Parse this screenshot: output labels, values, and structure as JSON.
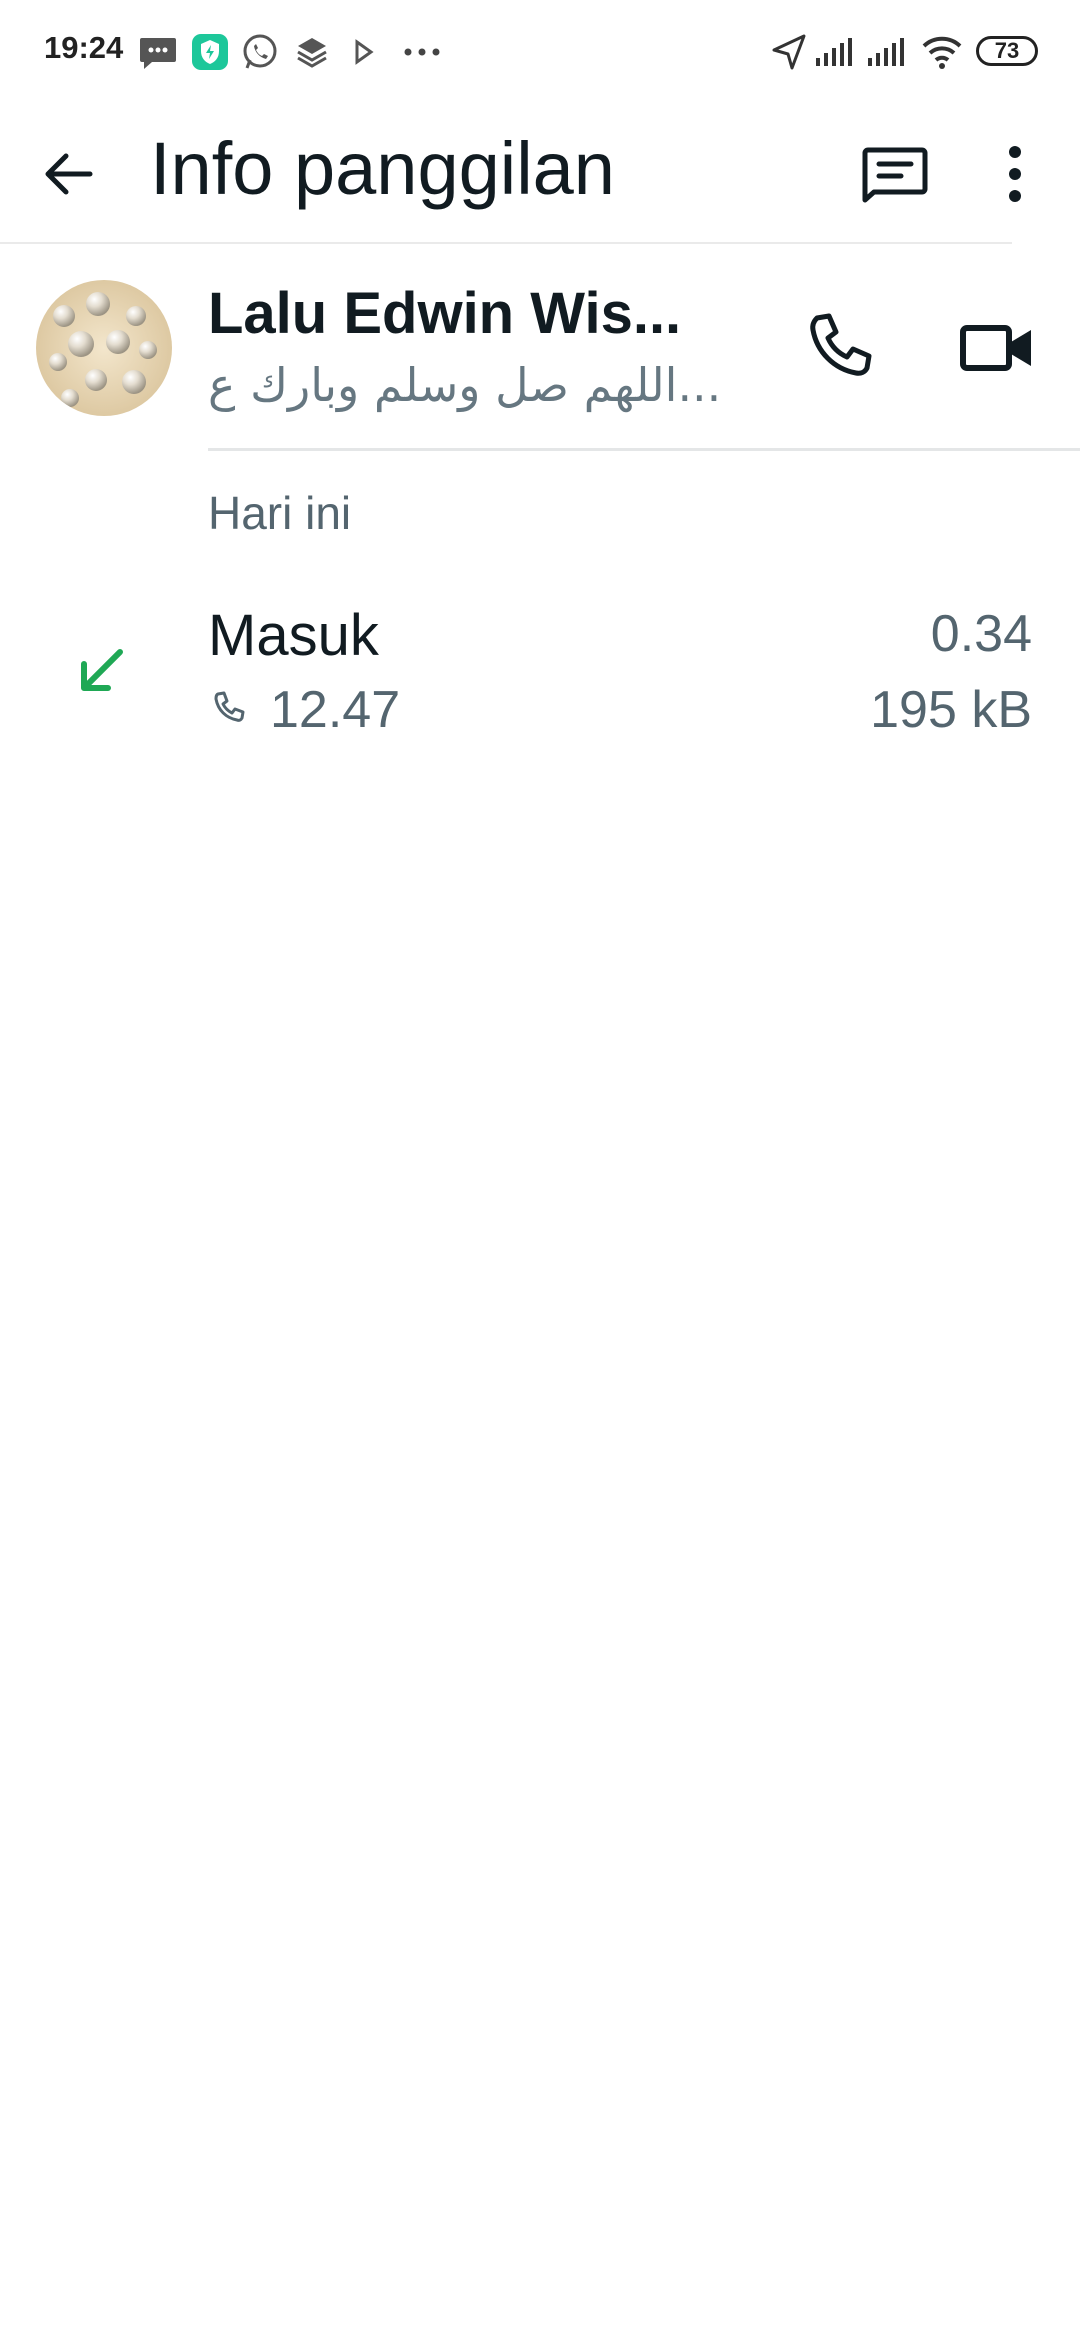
{
  "status_bar": {
    "time": "19:24",
    "battery": "73",
    "left_icons": [
      "message-icon",
      "shield-app-icon",
      "whatsapp-icon",
      "layers-icon",
      "play-icon",
      "more-dots-icon"
    ],
    "right_icons": [
      "location-arrow-icon",
      "signal-icon",
      "signal-icon",
      "wifi-icon",
      "battery-icon"
    ]
  },
  "app_bar": {
    "title": "Info panggilan",
    "back_icon": "arrow-left-icon",
    "message_icon": "message-icon",
    "more_icon": "more-vertical-icon"
  },
  "contact": {
    "name": "Lalu Edwin Wis...",
    "status": "اللهم صل وسلم وبارك ع...",
    "call_icon": "phone-icon",
    "video_icon": "video-icon"
  },
  "section_label": "Hari ini",
  "calls": [
    {
      "type": "Masuk",
      "time": "12.47",
      "duration": "0.34",
      "size": "195 kB",
      "direction_icon": "incoming-arrow-icon",
      "direction_color": "#1fa855"
    }
  ],
  "colors": {
    "primary_text": "#111b21",
    "secondary_text": "#54656f",
    "incoming": "#1fa855",
    "shield_app": "#1dc79a"
  }
}
